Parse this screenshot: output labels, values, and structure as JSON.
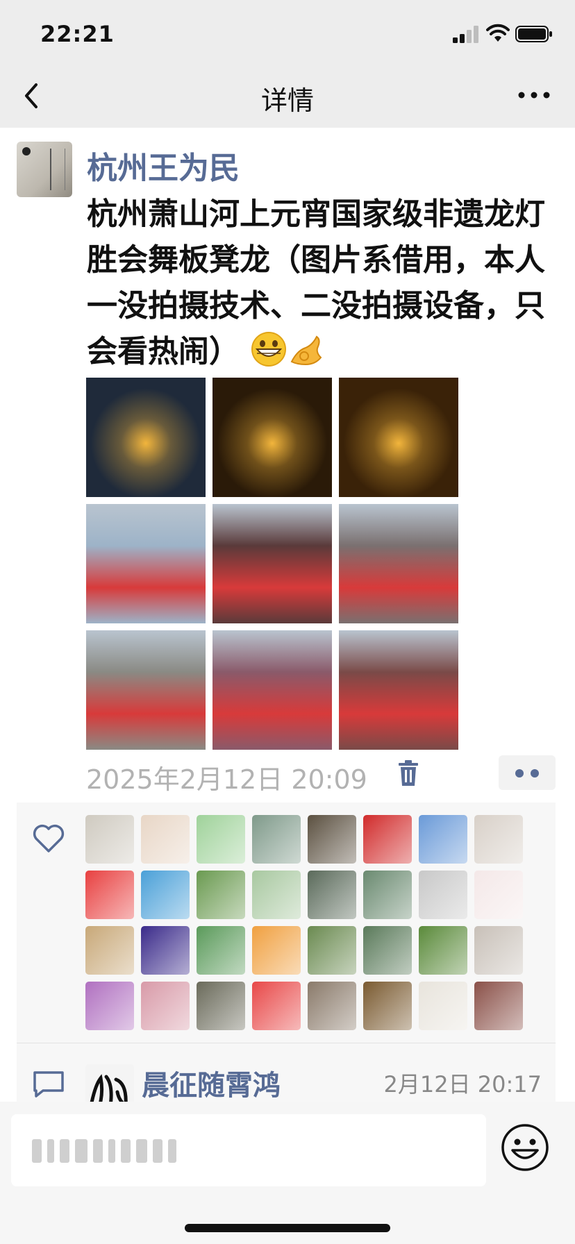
{
  "status_bar": {
    "time": "22:21"
  },
  "navbar": {
    "title": "详情",
    "back_icon": "chevron-left-icon",
    "more_icon": "more-dots-icon"
  },
  "post": {
    "author": "杭州王为民",
    "text": "杭州萧山河上元宵国家级非遗龙灯胜会舞板凳龙（图片系借用，本人一没拍摄技术、二没拍摄设备，只会看热闹）",
    "emojis": [
      "grin-emoji",
      "ok-hand-emoji"
    ],
    "photos": [
      {
        "name": "photo-1",
        "color": "#1f2a3a"
      },
      {
        "name": "photo-2",
        "color": "#2a1a08"
      },
      {
        "name": "photo-3",
        "color": "#3a2208"
      },
      {
        "name": "photo-4",
        "color": "#9db3c8"
      },
      {
        "name": "photo-5",
        "color": "#5a3a3a"
      },
      {
        "name": "photo-6",
        "color": "#7a7070"
      },
      {
        "name": "photo-7",
        "color": "#8a8a84"
      },
      {
        "name": "photo-8",
        "color": "#8a5a6a"
      },
      {
        "name": "photo-9",
        "color": "#7a4a48"
      }
    ],
    "timestamp": "2025年2月12日 20:09"
  },
  "likes": {
    "count": 32,
    "avatar_colors": [
      "#cfcac0",
      "#e8d6c6",
      "#9fd29a",
      "#7f9a8a",
      "#5b5040",
      "#d12b2b",
      "#6a9ad8",
      "#d8d0c8",
      "#e84040",
      "#4aa0d8",
      "#6a9a50",
      "#a8c8a0",
      "#5a6a5a",
      "#6a8a70",
      "#c8c8c8",
      "#f4e8e8",
      "#c8a878",
      "#3a2a8a",
      "#5a9a5a",
      "#f0a040",
      "#6a8a50",
      "#5a7a5a",
      "#5a8a3a",
      "#c8c0b8",
      "#b070c0",
      "#d89aa8",
      "#6a6a5a",
      "#e84848",
      "#8a7a6a",
      "#7a5a30",
      "#e8e4dc",
      "#8a5048"
    ]
  },
  "comment": {
    "author": "晨征随霄鸿",
    "time": "2月12日 20:17"
  },
  "input": {
    "placeholder": "",
    "emoji_icon": "smile-icon"
  }
}
